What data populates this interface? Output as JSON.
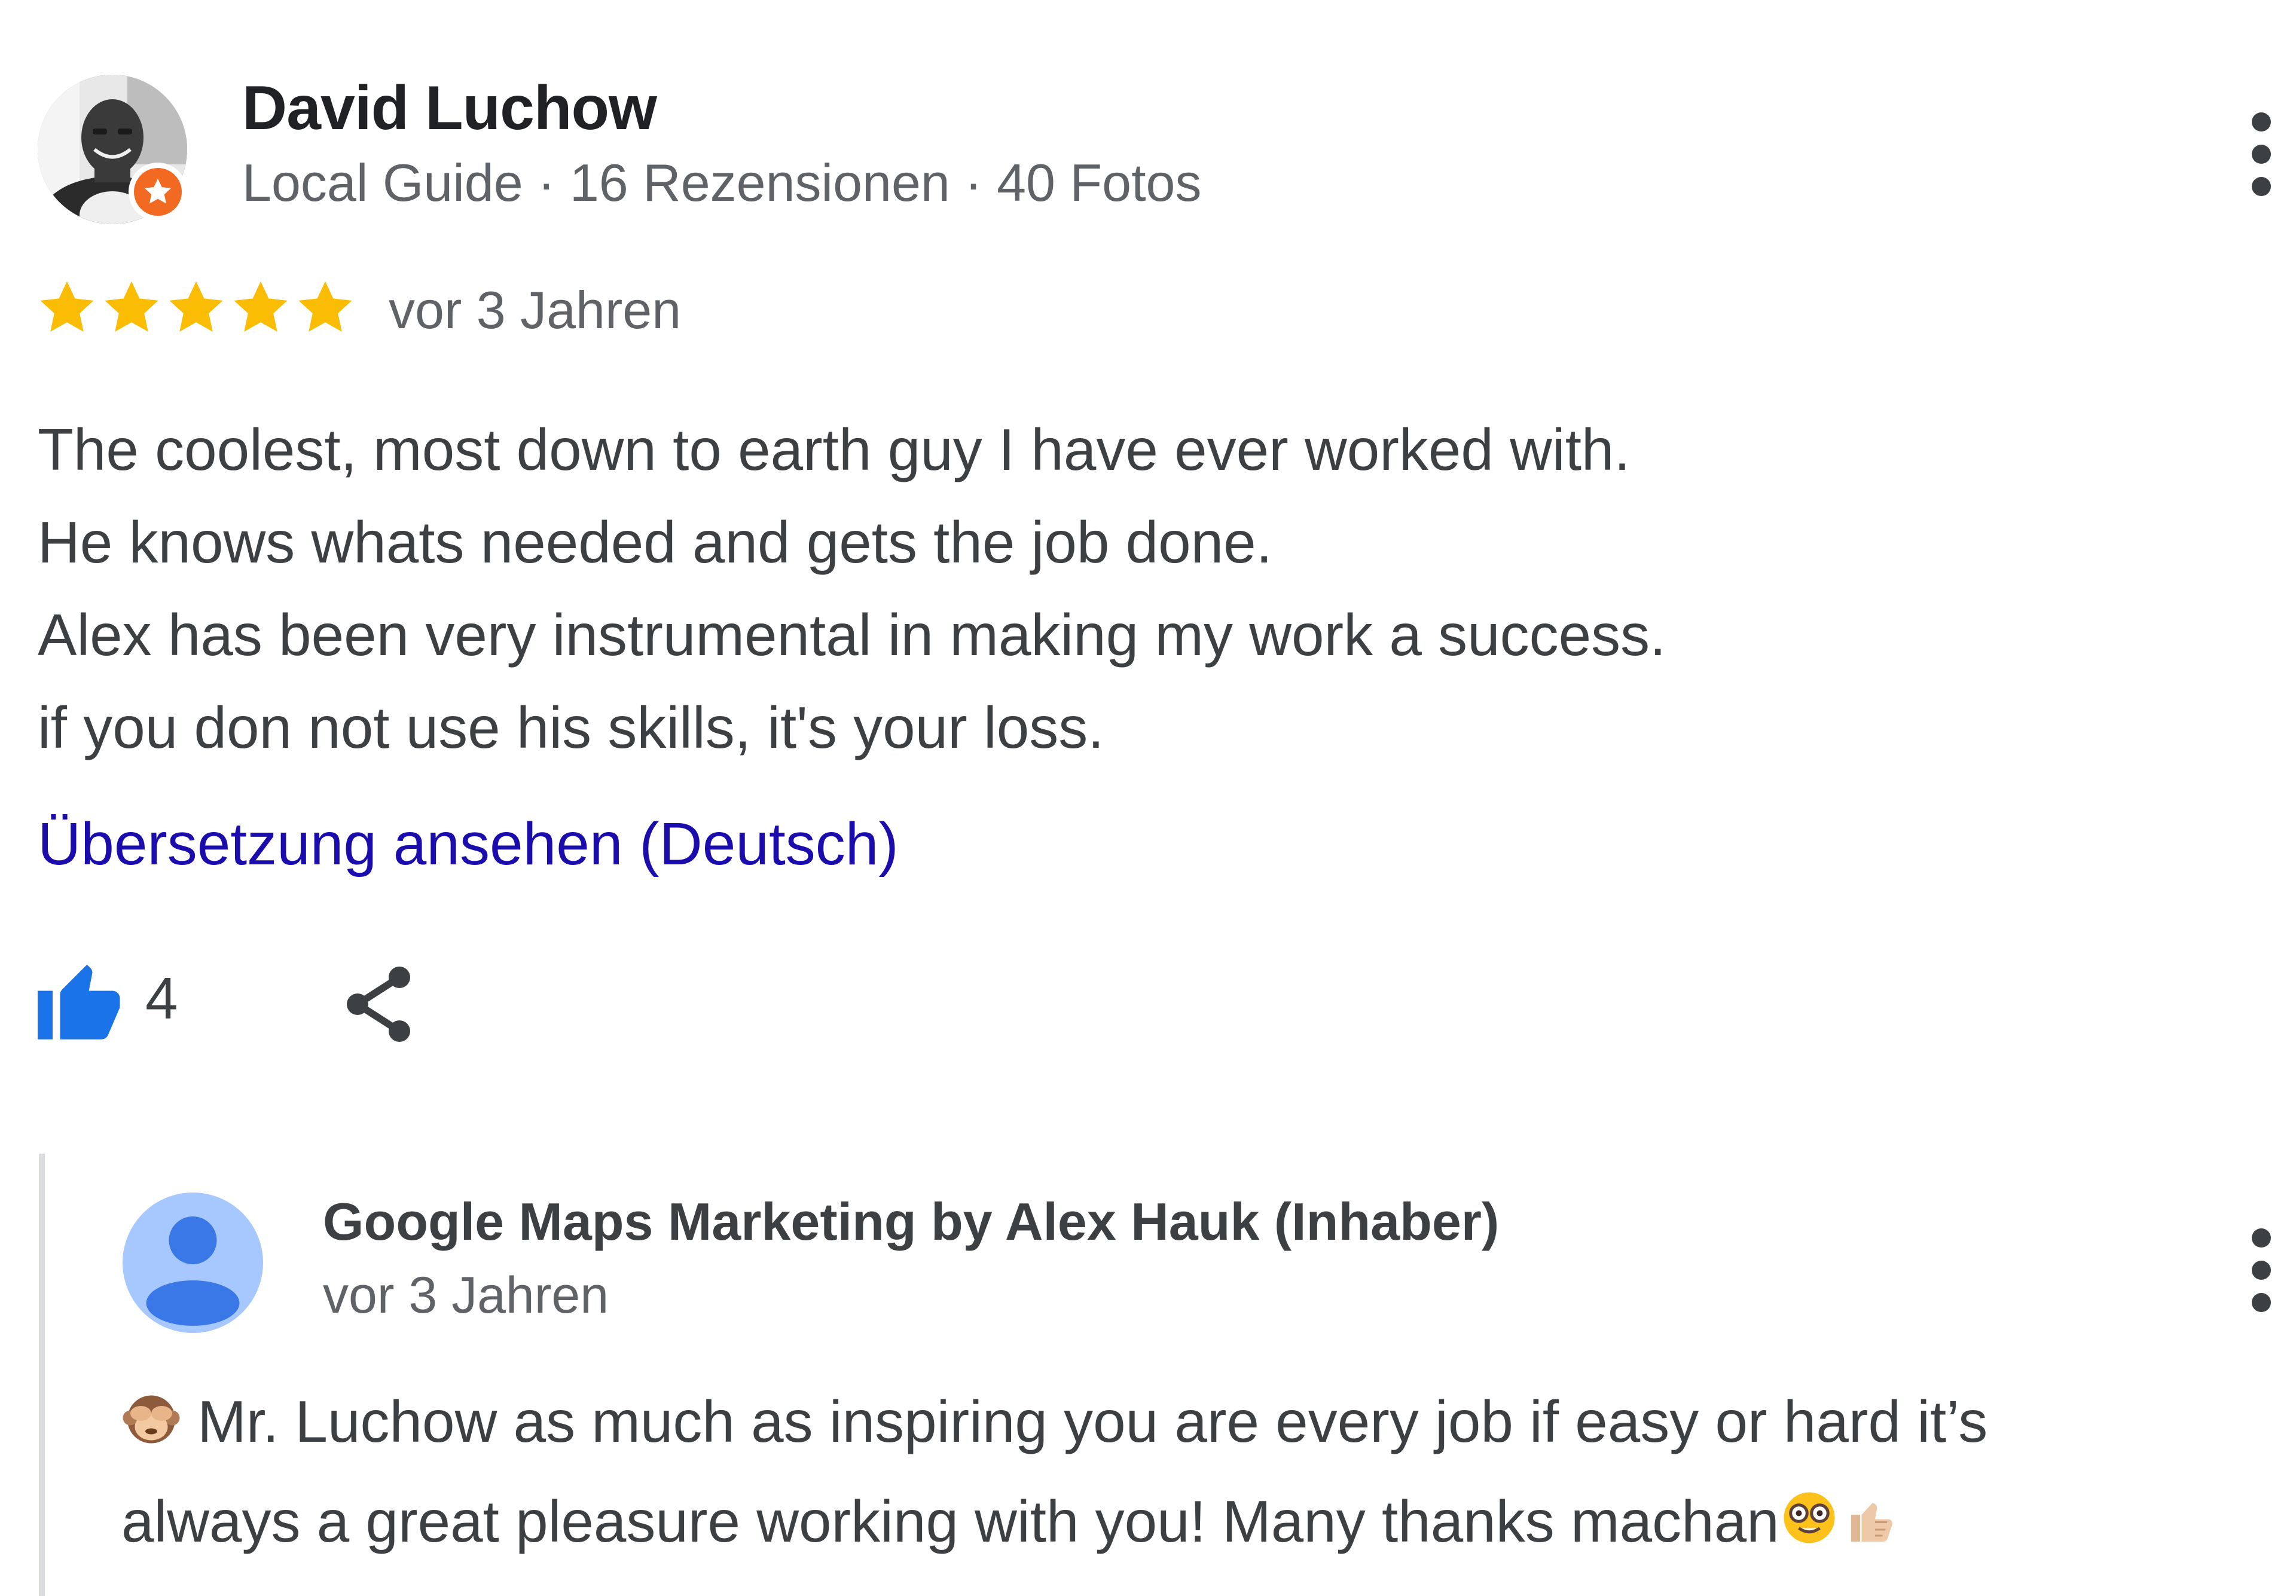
{
  "review": {
    "author_name": "David Luchow",
    "author_meta": "Local Guide · 16 Rezensionen · 40 Fotos",
    "rating": 5,
    "max_rating": 5,
    "date": "vor 3 Jahren",
    "text_lines": [
      "The coolest, most down to earth guy I have ever worked with.",
      "He knows whats needed and gets the job done.",
      "Alex has been very instrumental in making my work a success.",
      "if you don not use his skills, it's your loss."
    ],
    "translate_link": "Übersetzung ansehen (Deutsch)",
    "like_count": "4"
  },
  "reply": {
    "owner_name": "Google Maps Marketing by Alex Hauk (Inhaber)",
    "date": "vor 3 Jahren",
    "text_line_1": "Mr. Luchow as much as inspiring you are every job if easy or hard it’s",
    "text_line_2": "always a great pleasure working with you! Many thanks machan"
  },
  "colors": {
    "star": "#fbbc04",
    "link": "#1a0dab",
    "like_icon": "#1a73e8",
    "local_guide_badge": "#f26a21",
    "owner_avatar_bg": "#a6c8ff",
    "owner_avatar_fg": "#3b78e7"
  },
  "icons": {
    "local_guide_badge": "star-badge-icon",
    "more_options": "more-vert-icon",
    "like": "thumbs-up-icon",
    "share": "share-icon",
    "owner_avatar": "person-icon",
    "reply_emoji_1": "see-no-evil-monkey-emoji",
    "reply_emoji_2": "nerd-face-emoji",
    "reply_emoji_3": "thumbs-up-light-skin-emoji"
  }
}
